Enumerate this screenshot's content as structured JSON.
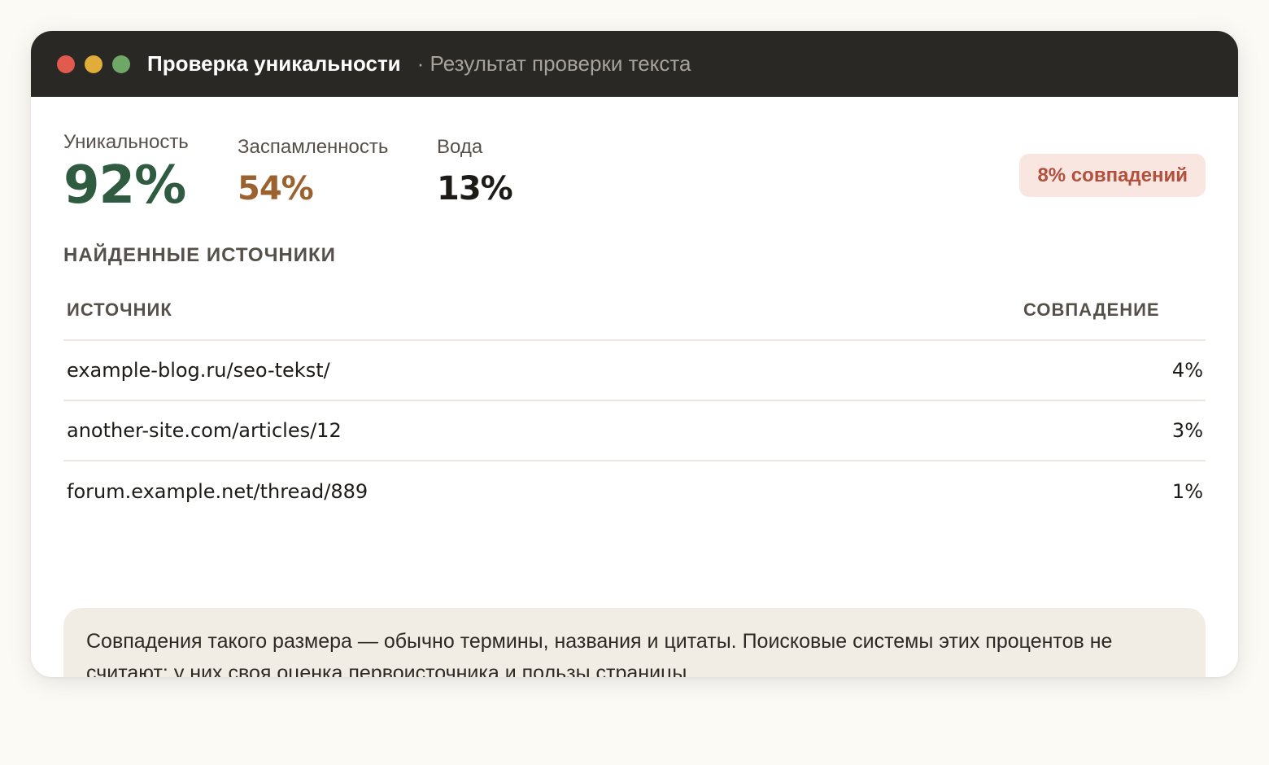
{
  "window": {
    "title": "Проверка уникальности",
    "subtitle": "· Результат проверки текста"
  },
  "colors": {
    "titlebar": "#2a2824",
    "uniqueness": "#2f5b40",
    "spam": "#9b6230",
    "badge_bg": "#f9e6e1",
    "badge_text": "#b2503d",
    "note_bg": "#f2ede4"
  },
  "stats": {
    "uniqueness": {
      "label": "Уникальность",
      "value": "92%"
    },
    "spam": {
      "label": "Заспамленность",
      "value": "54%"
    },
    "water": {
      "label": "Вода",
      "value": "13%"
    }
  },
  "badge": {
    "label": "8% совпадений"
  },
  "sources": {
    "title": "НАЙДЕННЫЕ ИСТОЧНИКИ",
    "headers": {
      "source": "ИСТОЧНИК",
      "match": "СОВПАДЕНИЕ"
    },
    "rows": [
      {
        "source": "example-blog.ru/seo-tekst/",
        "match": "4%"
      },
      {
        "source": "another-site.com/articles/12",
        "match": "3%"
      },
      {
        "source": "forum.example.net/thread/889",
        "match": "1%"
      }
    ]
  },
  "note": {
    "text": "Совпадения такого размера — обычно термины, названия и цитаты. Поисковые системы этих процентов не считают: у них своя оценка первоисточника и пользы страницы."
  }
}
